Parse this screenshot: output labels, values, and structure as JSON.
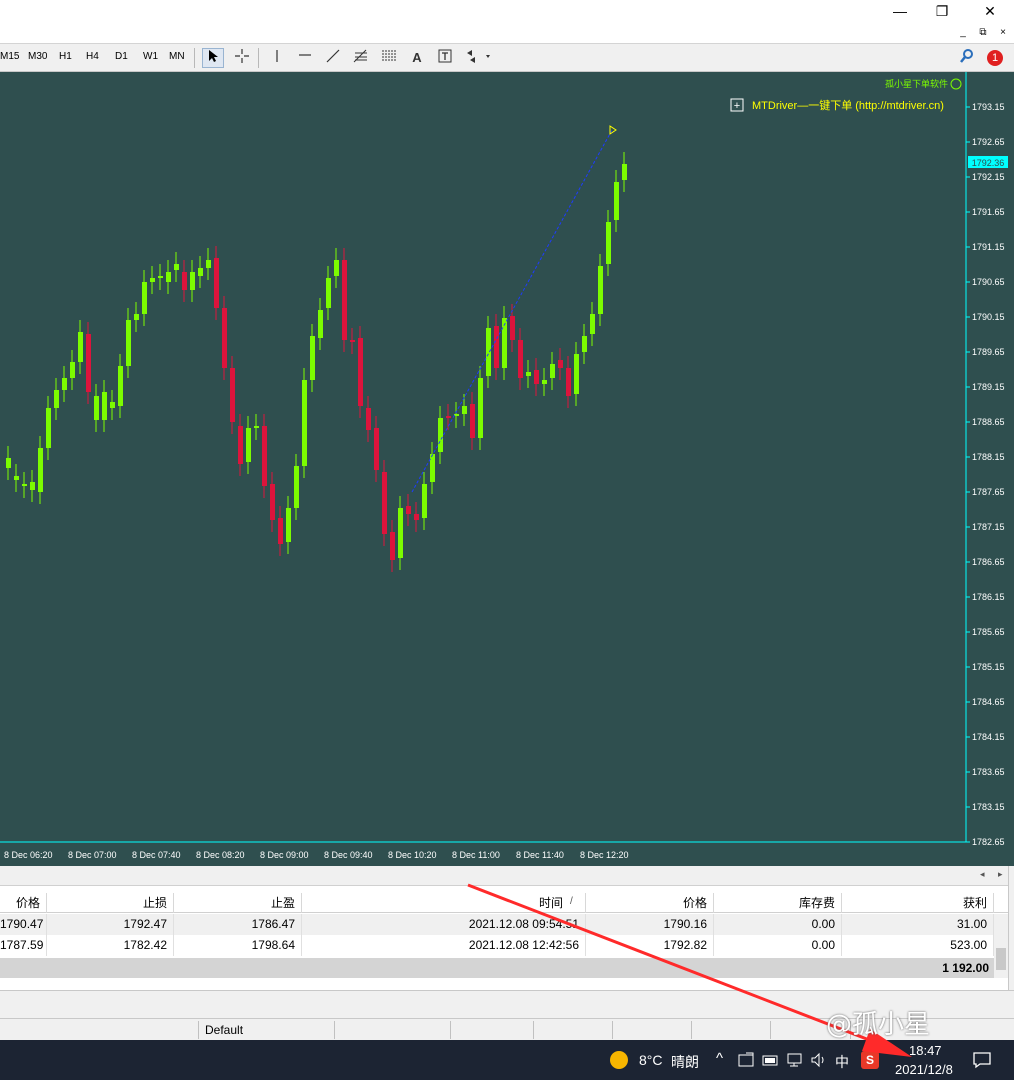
{
  "window": {
    "minimize": "—",
    "restore": "❐",
    "close": "✕"
  },
  "mdi": {
    "minimize": "_",
    "restore": "⧉",
    "close": "×"
  },
  "toolbar": {
    "timeframes": [
      "M15",
      "M30",
      "H1",
      "H4",
      "D1",
      "W1",
      "MN"
    ],
    "tools": [
      "cursor-icon",
      "crosshair-icon",
      "vertical-line-icon",
      "horizontal-line-icon",
      "trendline-icon",
      "fibonacci-icon",
      "fibo-fan-icon",
      "text-icon",
      "text-label-icon",
      "arrows-icon"
    ],
    "text_tool": "A",
    "search_icon": "search-icon",
    "notification_count": "1"
  },
  "chart": {
    "indicator_label": "孤小星下单软件",
    "ea_label": "MTDriver—一键下单 (http://mtdriver.cn)",
    "expand_box": "+",
    "current_price": "1792.36",
    "price_labels": [
      "1793.15",
      "1792.65",
      "1792.15",
      "1791.65",
      "1791.15",
      "1790.65",
      "1790.15",
      "1789.65",
      "1789.15",
      "1788.65",
      "1788.15",
      "1787.65",
      "1787.15",
      "1786.65",
      "1786.15",
      "1785.65",
      "1785.15",
      "1784.65",
      "1784.15",
      "1783.65",
      "1783.15",
      "1782.65"
    ],
    "time_labels": [
      "8 Dec 06:20",
      "8 Dec 07:00",
      "8 Dec 07:40",
      "8 Dec 08:20",
      "8 Dec 09:00",
      "8 Dec 09:40",
      "8 Dec 10:20",
      "8 Dec 11:00",
      "8 Dec 11:40",
      "8 Dec 12:20"
    ],
    "colors": {
      "background": "#2f4f4f",
      "bull": "#7cfc00",
      "bear": "#dc143c",
      "axis": "#00ffff",
      "label": "#ffff00"
    }
  },
  "terminal": {
    "headers": [
      "价格",
      "止损",
      "止盈",
      "时间",
      "价格",
      "库存费",
      "获利"
    ],
    "sort_indicator": "/",
    "rows": [
      [
        "1790.47",
        "1792.47",
        "1786.47",
        "2021.12.08 09:54:51",
        "1790.16",
        "0.00",
        "31.00"
      ],
      [
        "1787.59",
        "1782.42",
        "1798.64",
        "2021.12.08 12:42:56",
        "1792.82",
        "0.00",
        "523.00"
      ]
    ],
    "total": "1 192.00"
  },
  "statusbar": {
    "profile": "Default"
  },
  "taskbar": {
    "weather_temp": "8°C",
    "weather_text": "晴朗",
    "ime": "中",
    "time": "18:47",
    "date": "2021/12/8",
    "watermark": "@孤小星"
  }
}
